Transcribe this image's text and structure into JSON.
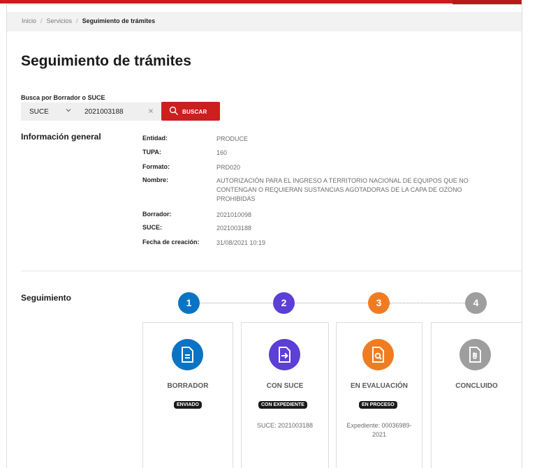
{
  "breadcrumb": {
    "items": [
      "Inicio",
      "Servicios"
    ],
    "separator": "/",
    "current": "Seguimiento de trámites"
  },
  "page_title": "Seguimiento de trámites",
  "search": {
    "label": "Busca por Borrador o SUCE",
    "type_value": "SUCE",
    "input_value": "2021003188",
    "clear_icon": "close-icon",
    "button_label": "BUSCAR"
  },
  "info": {
    "title": "Información general",
    "rows": [
      {
        "label": "Entidad:",
        "value": "PRODUCE"
      },
      {
        "label": "TUPA:",
        "value": "160"
      },
      {
        "label": "Formato:",
        "value": "PRD020"
      },
      {
        "label": "Nombre:",
        "value": "AUTORIZACIÓN PARA EL INGRESO A TERRITORIO NACIONAL DE EQUIPOS QUE NO CONTENGAN O REQUIERAN SUSTANCIAS AGOTADORAS DE LA CAPA DE OZONO PROHIBIDAS"
      },
      {
        "label": "Borrador:",
        "value": "2021010098"
      },
      {
        "label": "SUCE:",
        "value": "2021003188"
      },
      {
        "label": "Fecha de creación:",
        "value": "31/08/2021 10:19"
      }
    ]
  },
  "tracking": {
    "title": "Seguimiento",
    "steps": [
      {
        "number": "1",
        "color": "#0a74c4",
        "icon": "document-icon",
        "label": "BORRADOR",
        "badge": "ENVIADO",
        "detail": ""
      },
      {
        "number": "2",
        "color": "#5b3fd6",
        "icon": "file-arrow-icon",
        "label": "CON SUCE",
        "badge": "CON EXPEDIENTE",
        "detail": "SUCE: 2021003188"
      },
      {
        "number": "3",
        "color": "#f07c22",
        "icon": "file-search-icon",
        "label": "EN EVALUACIÓN",
        "badge": "EN PROCESO",
        "detail": "Expediente: 00036989-2021"
      },
      {
        "number": "4",
        "color": "#9e9e9e",
        "icon": "attachment-file-icon",
        "label": "CONCLUIDO",
        "badge": "",
        "detail": ""
      }
    ]
  },
  "colors": {
    "brand_red": "#c91c1c",
    "button_red": "#cc1f1f"
  }
}
